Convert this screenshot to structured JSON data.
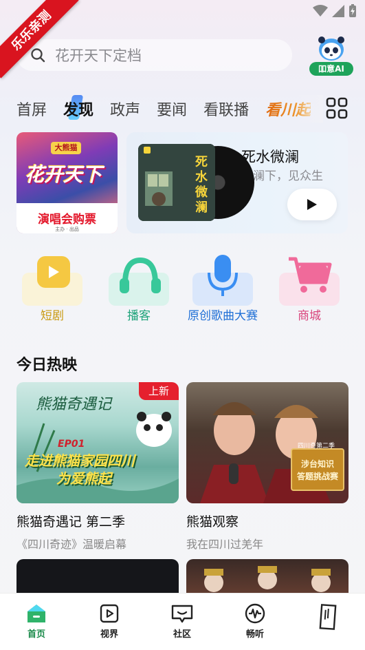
{
  "ribbon": {
    "text": "乐乐亲测"
  },
  "search": {
    "placeholder": "花开天下定档"
  },
  "ai_entry": {
    "label": "吅意AI"
  },
  "tabs": [
    {
      "label": "首屏"
    },
    {
      "label": "发现",
      "active": true
    },
    {
      "label": "政声"
    },
    {
      "label": "要闻"
    },
    {
      "label": "看联播"
    },
    {
      "label": "看川起"
    }
  ],
  "banner_left": {
    "top_text": "大熊猫",
    "title": "花开天下",
    "cta": "演唱会购票",
    "footer": "主办 · 出品"
  },
  "banner_right": {
    "cover_text": "死水微澜",
    "title": "死水微澜",
    "subtitle": "微澜下，见众生"
  },
  "quick_entries": [
    {
      "label": "短剧",
      "icon": "play-icon",
      "color": "#f5c842"
    },
    {
      "label": "播客",
      "icon": "headphones-icon",
      "color": "#38c89a"
    },
    {
      "label": "原创歌曲大赛",
      "icon": "microphone-icon",
      "color": "#3a8ef2"
    },
    {
      "label": "商城",
      "icon": "cart-icon",
      "color": "#f06a9a"
    }
  ],
  "section": {
    "title": "今日热映"
  },
  "cards": [
    {
      "title": "熊猫奇遇记  第二季",
      "subtitle": "《四川奇迹》温暖启幕",
      "badge": "上新",
      "thumb_script": "熊猫奇遇记",
      "thumb_ep": "EP01",
      "thumb_line1": "走进熊猫家园四川",
      "thumb_line2": "为爱熊起"
    },
    {
      "title": "熊猫观察",
      "subtitle": "我在四川过羌年",
      "stamp_top": "四川奇第二季",
      "stamp_line1": "涉台知识",
      "stamp_line2": "答题挑战赛"
    }
  ],
  "bottom_nav": [
    {
      "label": "首页",
      "active": true
    },
    {
      "label": "视界"
    },
    {
      "label": "社区"
    },
    {
      "label": "畅听"
    },
    {
      "label": ""
    }
  ],
  "colors": {
    "accent_green": "#1a8a4a",
    "badge_red": "#e5202e",
    "ribbon_red": "#d9141f"
  }
}
